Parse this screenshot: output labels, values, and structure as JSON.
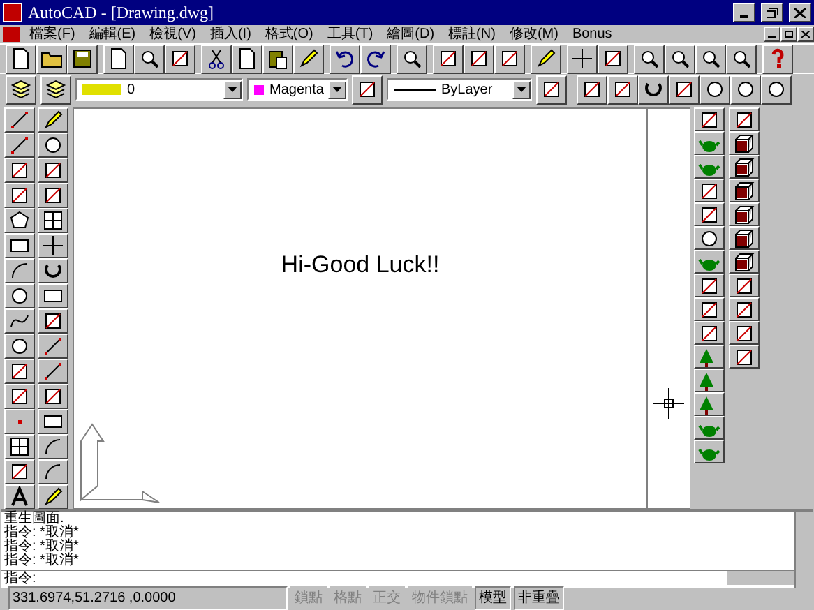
{
  "window": {
    "title": "AutoCAD - [Drawing.dwg]"
  },
  "menu": [
    "檔案(F)",
    "編輯(E)",
    "檢視(V)",
    "插入(I)",
    "格式(O)",
    "工具(T)",
    "繪圖(D)",
    "標註(N)",
    "修改(M)",
    "Bonus"
  ],
  "object_properties": {
    "layer": "0",
    "color_setting": {
      "name": "Magenta",
      "color": "#ff00ff"
    },
    "linetype": "ByLayer"
  },
  "canvas": {
    "text": "Hi-Good Luck!!"
  },
  "command_history": [
    "重生圖面.",
    "指令: *取消*",
    "指令: *取消*",
    "指令: *取消*"
  ],
  "command_prompt": "指令:",
  "status_bar": {
    "coordinates": "331.6974,51.2716 ,0.0000",
    "toggles": [
      {
        "label": "鎖點",
        "on": false
      },
      {
        "label": "格點",
        "on": false
      },
      {
        "label": "正交",
        "on": false
      },
      {
        "label": "物件鎖點",
        "on": false
      },
      {
        "label": "模型",
        "on": true
      },
      {
        "label": "非重疊",
        "on": true
      }
    ]
  }
}
